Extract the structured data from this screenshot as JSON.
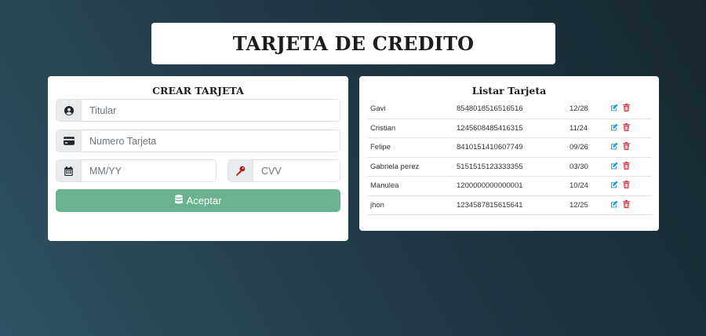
{
  "title": "TARJETA DE CREDITO",
  "form": {
    "heading": "CREAR TARJETA",
    "titular": {
      "placeholder": "Titular",
      "icon": "user-circle-icon"
    },
    "numero": {
      "placeholder": "Numero Tarjeta",
      "icon": "credit-card-icon"
    },
    "expiry": {
      "placeholder": "MM/YY",
      "icon": "calendar-icon"
    },
    "cvv": {
      "placeholder": "CVV",
      "icon": "key-icon"
    },
    "submit_label": "Aceptar",
    "submit_icon": "database-icon"
  },
  "list": {
    "heading": "Listar Tarjeta",
    "rows": [
      {
        "name": "Gavi",
        "number": "8548018516516516",
        "expiry": "12/28"
      },
      {
        "name": "Cristian",
        "number": "1245608485416315",
        "expiry": "11/24"
      },
      {
        "name": "Felipe",
        "number": "8410151410607749",
        "expiry": "09/26"
      },
      {
        "name": "Gabriela perez",
        "number": "5151515123333355",
        "expiry": "03/30"
      },
      {
        "name": "Manulea",
        "number": "1200000000000001",
        "expiry": "10/24"
      },
      {
        "name": "jhon",
        "number": "1234587815615641",
        "expiry": "12/25"
      }
    ]
  },
  "colors": {
    "accept_button": "#6bb293",
    "edit_icon": "#1fa2d6",
    "delete_icon": "#dc3545",
    "key_icon": "#b01d1d"
  }
}
